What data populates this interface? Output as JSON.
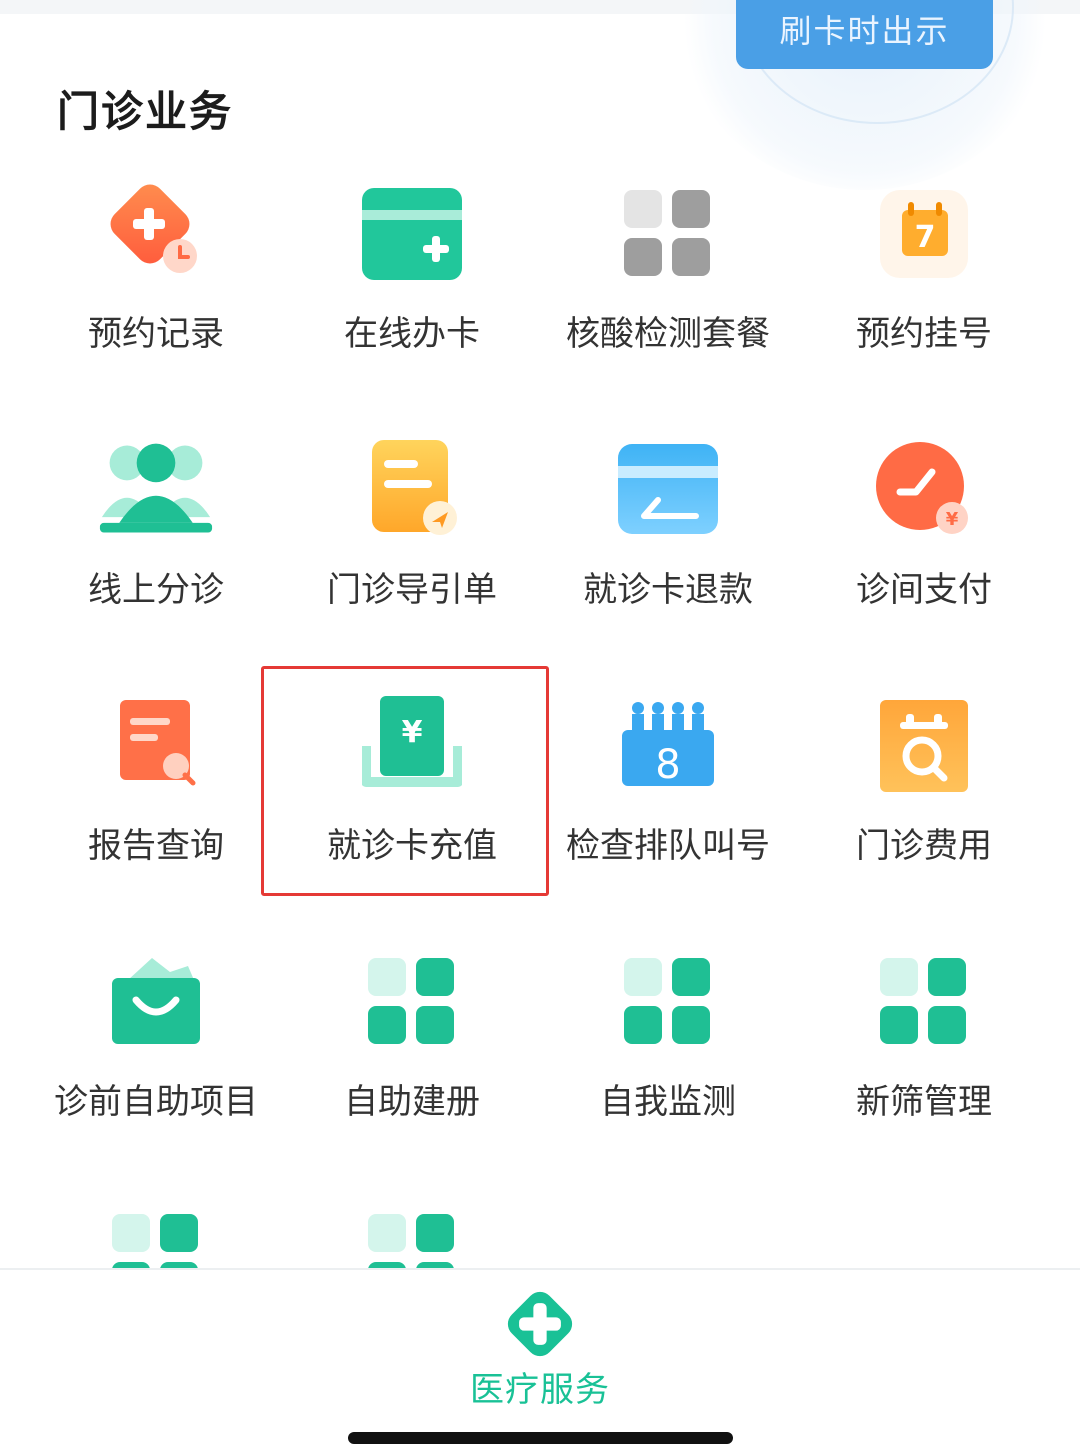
{
  "header": {
    "card_button_label": "刷卡时出示"
  },
  "section": {
    "title": "门诊业务",
    "items": [
      {
        "label": "预约记录",
        "icon": "calendar-plus-icon"
      },
      {
        "label": "在线办卡",
        "icon": "card-add-icon"
      },
      {
        "label": "核酸检测套餐",
        "icon": "grid-icon"
      },
      {
        "label": "预约挂号",
        "icon": "calendar-icon",
        "badge": "7"
      },
      {
        "label": "线上分诊",
        "icon": "people-icon"
      },
      {
        "label": "门诊导引单",
        "icon": "document-icon"
      },
      {
        "label": "就诊卡退款",
        "icon": "card-refund-icon"
      },
      {
        "label": "诊间支付",
        "icon": "payment-icon"
      },
      {
        "label": "报告查询",
        "icon": "report-search-icon"
      },
      {
        "label": "就诊卡充值",
        "icon": "card-recharge-icon",
        "highlighted": true
      },
      {
        "label": "检查排队叫号",
        "icon": "queue-number-icon",
        "badge": "8"
      },
      {
        "label": "门诊费用",
        "icon": "fee-icon"
      },
      {
        "label": "诊前自助项目",
        "icon": "bag-icon"
      },
      {
        "label": "自助建册",
        "icon": "grid-icon"
      },
      {
        "label": "自我监测",
        "icon": "grid-icon"
      },
      {
        "label": "新筛管理",
        "icon": "grid-icon"
      },
      {
        "label": "",
        "icon": "grid-icon"
      },
      {
        "label": "",
        "icon": "grid-icon"
      }
    ]
  },
  "tabbar": {
    "active_label": "医疗服务",
    "active_color": "#19c196"
  },
  "colors": {
    "green": "#22c79a",
    "orange": "#ff7a45",
    "blue": "#4a9fe6",
    "highlight": "#e53935"
  }
}
